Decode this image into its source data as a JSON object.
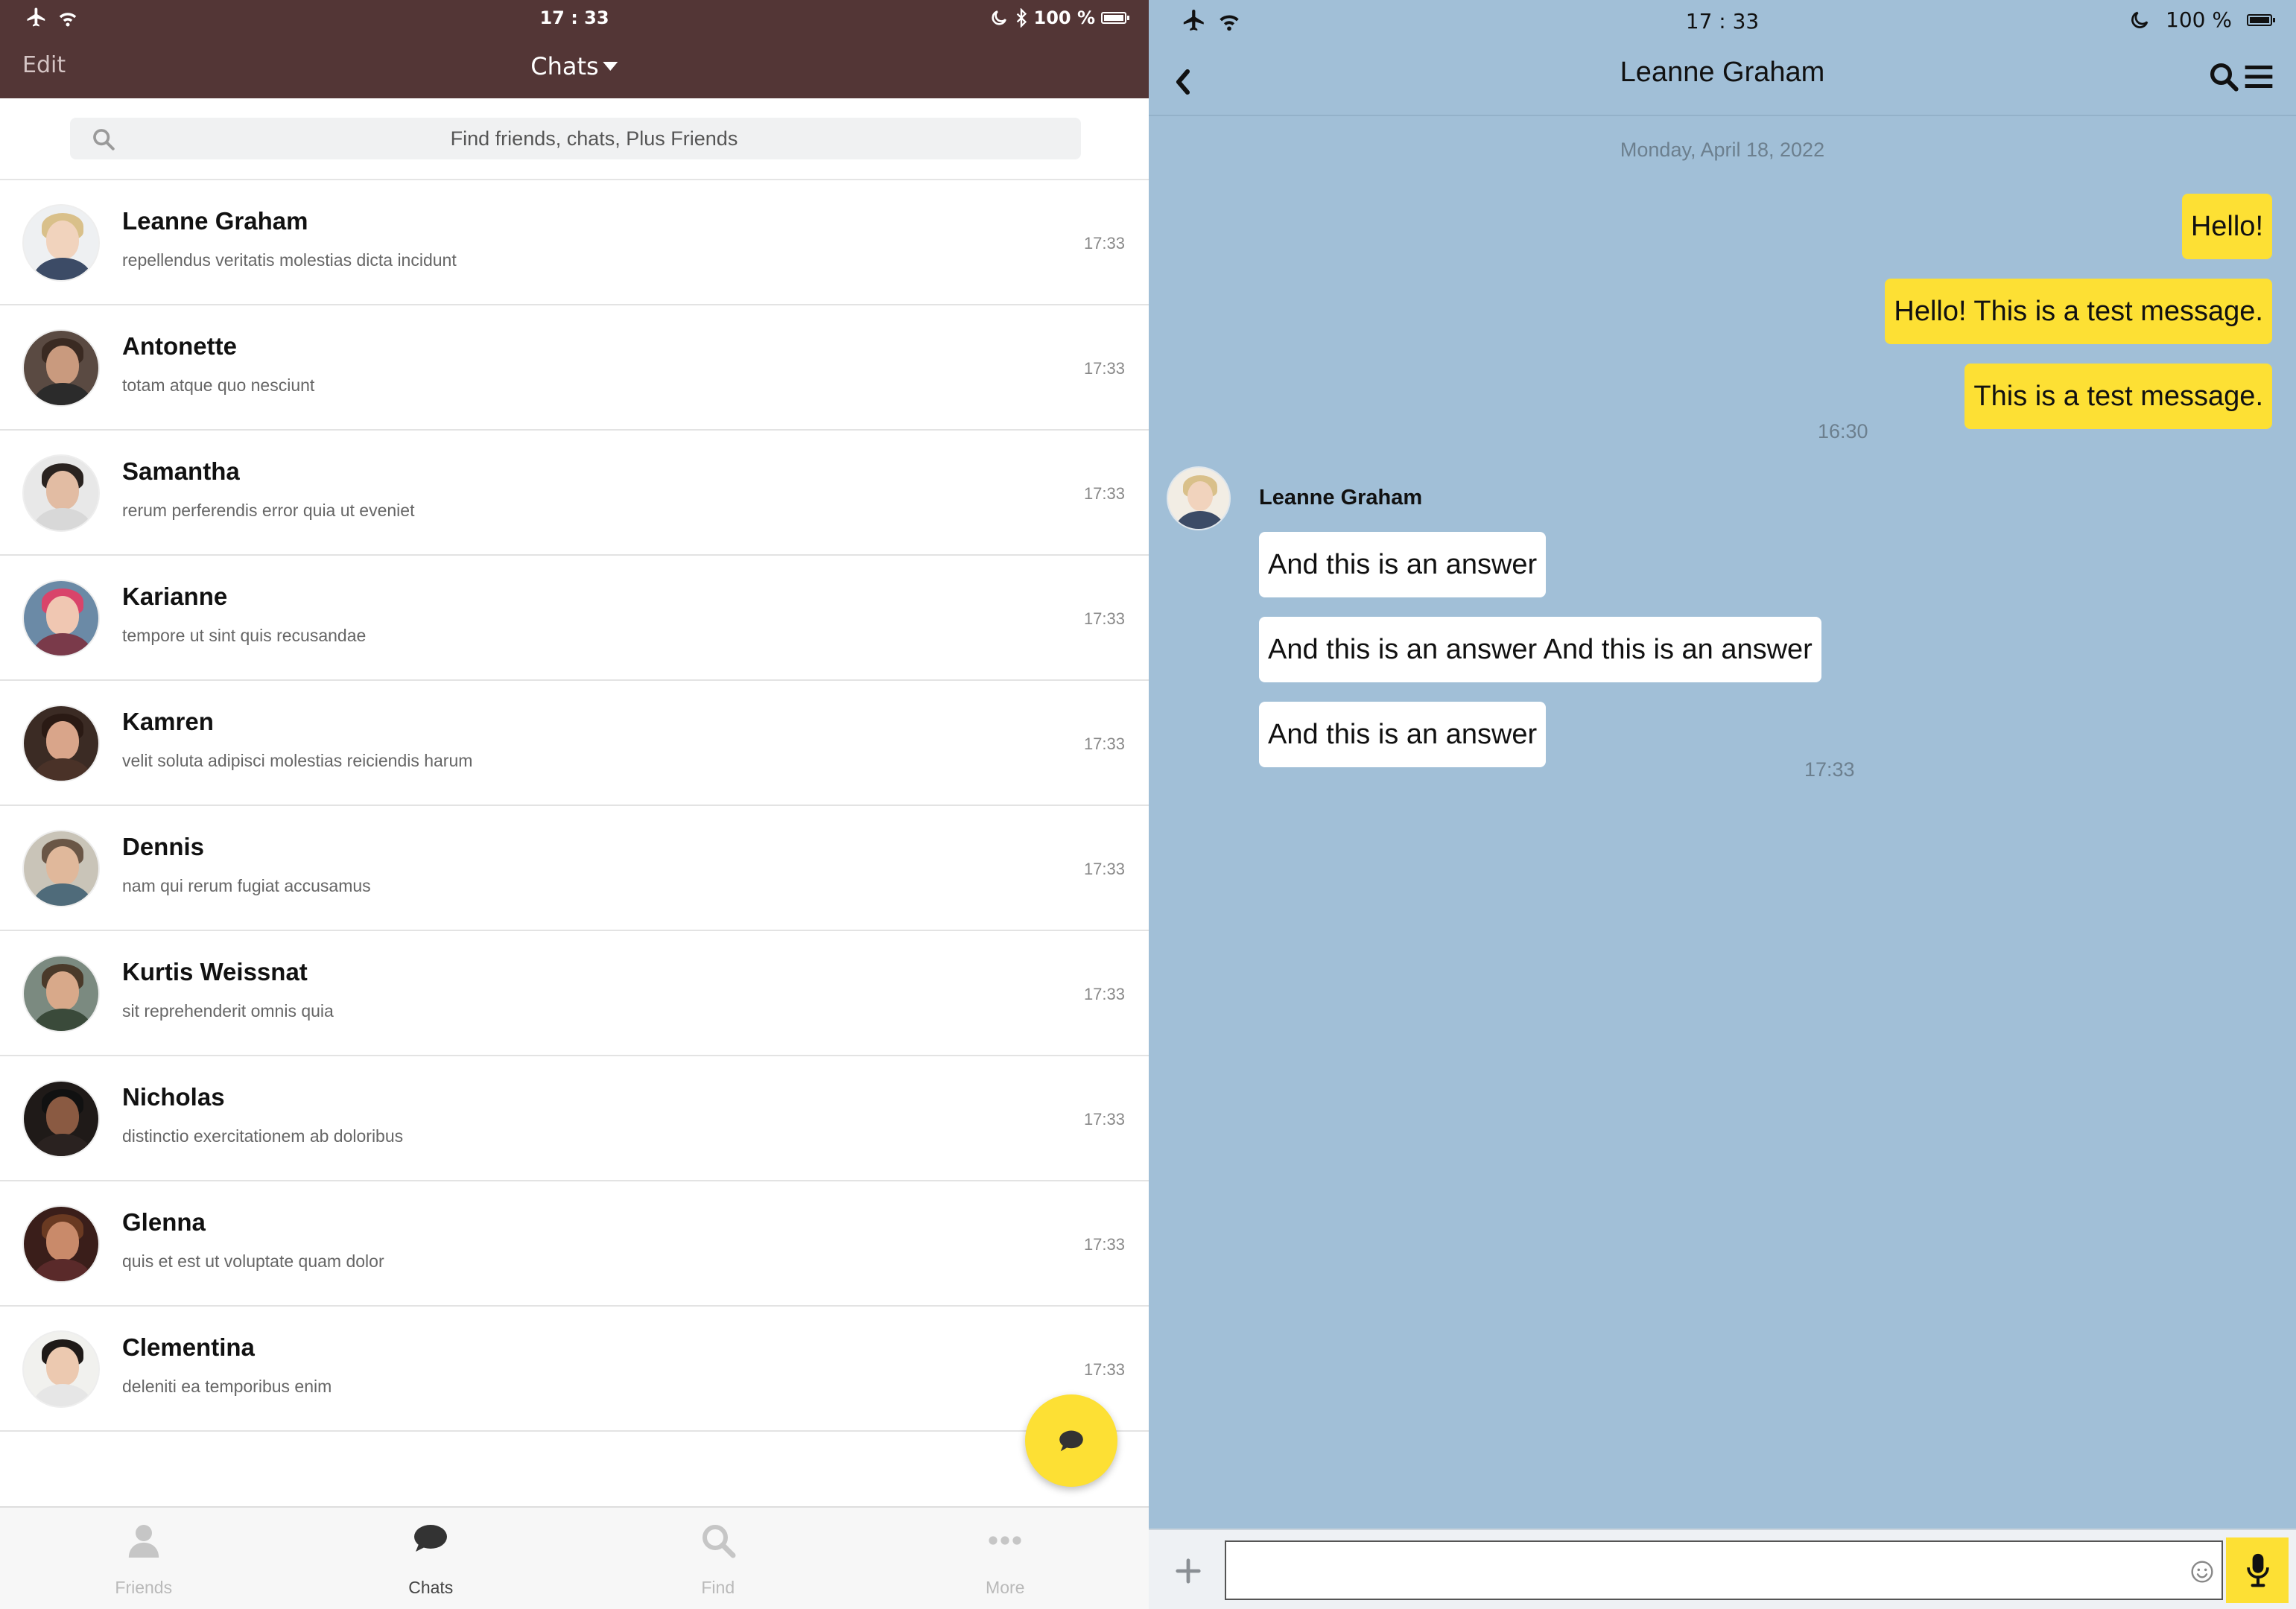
{
  "left": {
    "status": {
      "time": "17 : 33",
      "battery": "100 %"
    },
    "header": {
      "edit_label": "Edit",
      "title": "Chats"
    },
    "search": {
      "placeholder": "Find friends, chats, Plus Friends"
    },
    "chats": [
      {
        "name": "Leanne Graham",
        "preview": "repellendus veritatis molestias dicta incidunt",
        "time": "17:33"
      },
      {
        "name": "Antonette",
        "preview": "totam atque quo nesciunt",
        "time": "17:33"
      },
      {
        "name": "Samantha",
        "preview": "rerum perferendis error quia ut eveniet",
        "time": "17:33"
      },
      {
        "name": "Karianne",
        "preview": "tempore ut sint quis recusandae",
        "time": "17:33"
      },
      {
        "name": "Kamren",
        "preview": "velit soluta adipisci molestias reiciendis harum",
        "time": "17:33"
      },
      {
        "name": "Dennis",
        "preview": "nam qui rerum fugiat accusamus",
        "time": "17:33"
      },
      {
        "name": "Kurtis Weissnat",
        "preview": "sit reprehenderit omnis quia",
        "time": "17:33"
      },
      {
        "name": "Nicholas",
        "preview": "distinctio exercitationem ab doloribus",
        "time": "17:33"
      },
      {
        "name": "Glenna",
        "preview": "quis et est ut voluptate quam dolor",
        "time": "17:33"
      },
      {
        "name": "Clementina",
        "preview": "deleniti ea temporibus enim",
        "time": "17:33"
      }
    ],
    "tabs": [
      {
        "label": "Friends",
        "icon": "person-icon"
      },
      {
        "label": "Chats",
        "icon": "chat-bubble-icon"
      },
      {
        "label": "Find",
        "icon": "search-icon"
      },
      {
        "label": "More",
        "icon": "more-dots-icon"
      }
    ]
  },
  "right": {
    "status": {
      "time": "17 : 33",
      "battery": "100 %"
    },
    "header": {
      "title": "Leanne Graham"
    },
    "date_separator": "Monday, April 18, 2022",
    "outgoing": {
      "messages": [
        "Hello!",
        "Hello! This is a test message.",
        "This is a test message."
      ],
      "time": "16:30"
    },
    "incoming": {
      "sender": "Leanne Graham",
      "messages": [
        "And this is an answer",
        "And this is an answer And this is an answer",
        "And this is an answer"
      ],
      "time": "17:33"
    },
    "composer": {
      "value": ""
    }
  },
  "colors": {
    "header_brown": "#533636",
    "accent_yellow": "#fde034",
    "chat_bg": "#a1bfd7"
  }
}
